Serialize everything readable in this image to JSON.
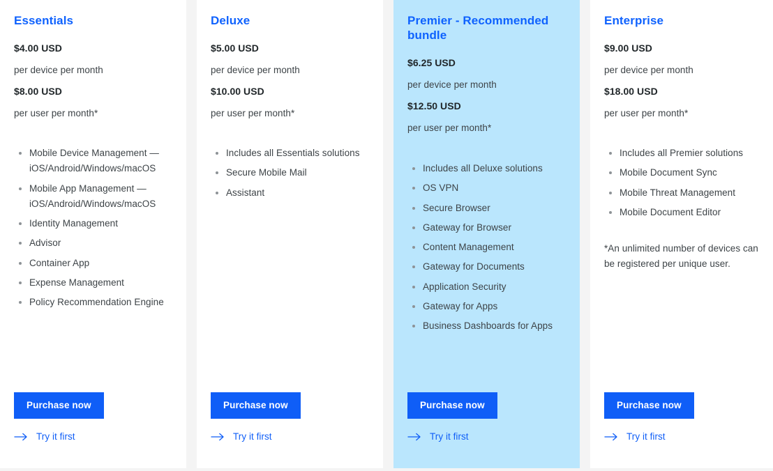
{
  "theme": {
    "accent": "#0f62fe",
    "button_blue": "#0f5ef7",
    "highlight_bg": "#bae6fd",
    "card_bg": "#ffffff",
    "page_bg": "#f4f4f4",
    "text_dark": "#21272a",
    "text_body": "#3d4347",
    "bullet": "#8d9296"
  },
  "labels": {
    "purchase": "Purchase now",
    "try": "Try it first",
    "arrow_icon": "arrow-right-icon",
    "bullet_icon": "bullet-dot-icon"
  },
  "plans": [
    {
      "name": "Essentials",
      "device_price": "$4.00 USD",
      "device_note": "per device per month",
      "user_price": "$8.00 USD",
      "user_note": "per user per month*",
      "highlighted": false,
      "features": [
        "Mobile Device Management — iOS/Android/Windows/macOS",
        "Mobile App Management — iOS/Android/Windows/macOS",
        "Identity Management",
        "Advisor",
        "Container App",
        "Expense Management",
        "Policy Recommendation Engine"
      ],
      "footnote": ""
    },
    {
      "name": "Deluxe",
      "device_price": "$5.00 USD",
      "device_note": "per device per month",
      "user_price": "$10.00 USD",
      "user_note": "per user per month*",
      "highlighted": false,
      "features": [
        "Includes all Essentials solutions",
        "Secure Mobile Mail",
        "Assistant"
      ],
      "footnote": ""
    },
    {
      "name": "Premier - Recommended bundle",
      "device_price": "$6.25 USD",
      "device_note": "per device per month",
      "user_price": "$12.50 USD",
      "user_note": "per user per month*",
      "highlighted": true,
      "features": [
        "Includes all Deluxe solutions",
        "OS VPN",
        "Secure Browser",
        "Gateway for Browser",
        "Content Management",
        "Gateway for Documents",
        "Application Security",
        "Gateway for Apps",
        "Business Dashboards for Apps"
      ],
      "footnote": ""
    },
    {
      "name": "Enterprise",
      "device_price": "$9.00 USD",
      "device_note": "per device per month",
      "user_price": "$18.00 USD",
      "user_note": "per user per month*",
      "highlighted": false,
      "features": [
        "Includes all Premier solutions",
        "Mobile Document Sync",
        "Mobile Threat Management",
        "Mobile Document Editor"
      ],
      "footnote": "*An unlimited number of devices can be registered per unique user."
    }
  ]
}
